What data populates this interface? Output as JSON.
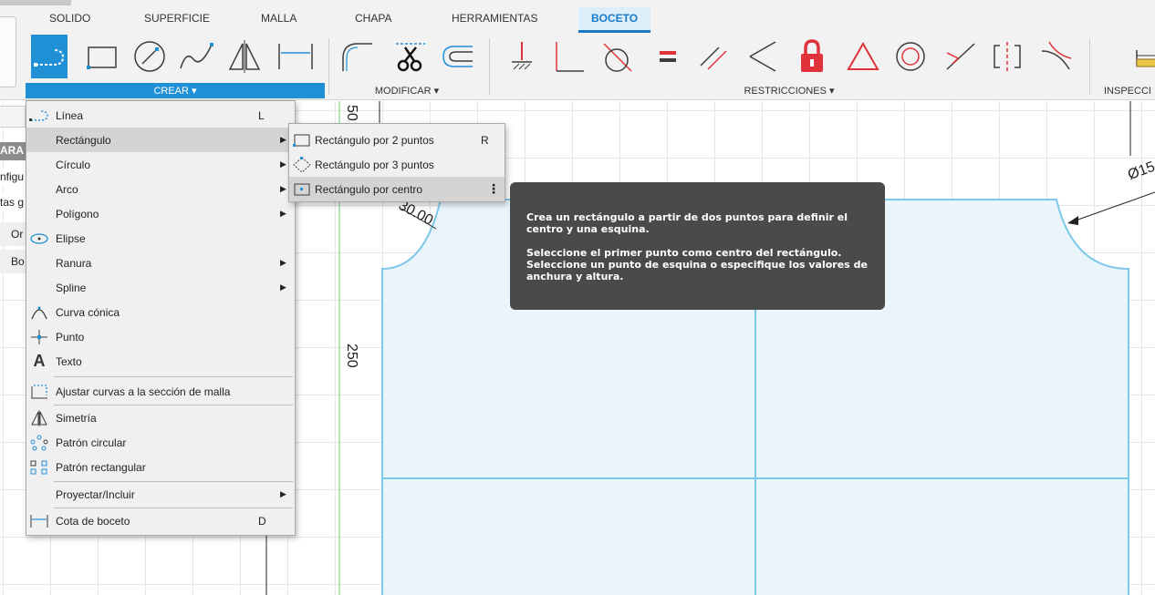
{
  "tabs": [
    "SOLIDO",
    "SUPERFICIE",
    "MALLA",
    "CHAPA",
    "HERRAMIENTAS",
    "BOCETO"
  ],
  "active_tab": "BOCETO",
  "groups": {
    "crear": "CREAR ▾",
    "modificar": "MODIFICAR ▾",
    "restricciones": "RESTRICCIONES ▾",
    "inspeccionar": "INSPECCI"
  },
  "crear_menu": {
    "items": [
      {
        "label": "Línea",
        "shortcut": "L",
        "icon": "line-icon"
      },
      {
        "label": "Rectángulo",
        "submenu": true
      },
      {
        "label": "Círculo",
        "submenu": true
      },
      {
        "label": "Arco",
        "submenu": true
      },
      {
        "label": "Polígono",
        "submenu": true
      },
      {
        "label": "Elipse",
        "icon": "ellipse-icon"
      },
      {
        "label": "Ranura",
        "submenu": true
      },
      {
        "label": "Spline",
        "submenu": true
      },
      {
        "label": "Curva cónica",
        "icon": "conic-curve-icon"
      },
      {
        "label": "Punto",
        "icon": "point-icon"
      },
      {
        "label": "Texto",
        "icon": "text-icon"
      },
      {
        "label": "Ajustar curvas a la sección de malla",
        "icon": "fit-curves-icon"
      },
      {
        "label": "Simetría",
        "icon": "mirror-icon"
      },
      {
        "label": "Patrón circular",
        "icon": "circular-pattern-icon"
      },
      {
        "label": "Patrón rectangular",
        "icon": "rectangular-pattern-icon"
      },
      {
        "label": "Proyectar/Incluir",
        "submenu": true
      },
      {
        "label": "Cota de boceto",
        "shortcut": "D",
        "icon": "sketch-dimension-icon"
      }
    ]
  },
  "rect_submenu": [
    {
      "label": "Rectángulo por 2 puntos",
      "shortcut": "R"
    },
    {
      "label": "Rectángulo por 3 puntos",
      "shortcut": ""
    },
    {
      "label": "Rectángulo por centro",
      "shortcut": ""
    }
  ],
  "tooltip": {
    "line1": "Crea un rectángulo a partir de dos puntos para definir el centro y una esquina.",
    "line2": "Seleccione el primer punto como centro del rectángulo. Seleccione un punto de esquina o especifique los valores de anchura y altura."
  },
  "left_panel": [
    "ARA",
    "nfigu",
    "tas g",
    "Or",
    "Bo"
  ],
  "dimensions": {
    "d50": "50",
    "d250": "250",
    "d30": "30.00",
    "d15": "Ø15"
  },
  "colors": {
    "accent": "#1f8fd6",
    "sketch_line": "#7ec8ea",
    "sketch_fill": "#e9f4fb",
    "constraint_red": "#e0323a",
    "tooltip_bg": "#4a4a4a"
  }
}
